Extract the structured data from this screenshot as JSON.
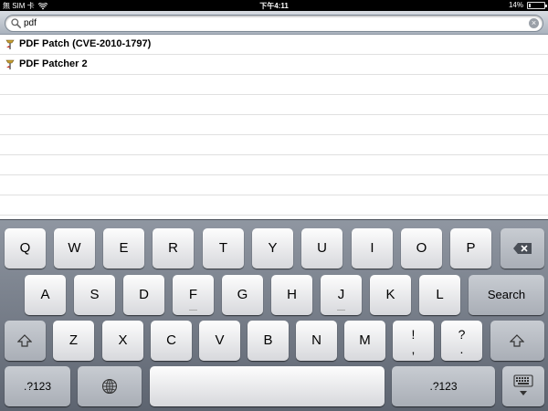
{
  "status_bar": {
    "carrier": "無 SIM 卡",
    "time": "下午4:11",
    "battery_percent": "14%",
    "battery_level": 0.14,
    "icons": [
      "wifi-icon",
      "battery-icon"
    ]
  },
  "search": {
    "value": "pdf",
    "icons": [
      "magnifier-icon",
      "clear-icon"
    ]
  },
  "results": [
    {
      "label": "PDF Patch (CVE-2010-1797)",
      "icon": "pin-icon"
    },
    {
      "label": "PDF Patcher 2",
      "icon": "pin-icon"
    }
  ],
  "keyboard": {
    "row1": [
      "Q",
      "W",
      "E",
      "R",
      "T",
      "Y",
      "U",
      "I",
      "O",
      "P"
    ],
    "backspace_icon": "backspace-icon",
    "row2": [
      "A",
      "S",
      "D",
      "F",
      "G",
      "H",
      "J",
      "K",
      "L"
    ],
    "search_label": "Search",
    "shift_icon": "shift-icon",
    "row3": [
      "Z",
      "X",
      "C",
      "V",
      "B",
      "N",
      "M"
    ],
    "punct1": {
      "top": "!",
      "bottom": ","
    },
    "punct2": {
      "top": "?",
      "bottom": "."
    },
    "numbers_label": ".?123",
    "globe_icon": "globe-icon",
    "hide_keyboard_icon": "hide-keyboard-icon"
  }
}
